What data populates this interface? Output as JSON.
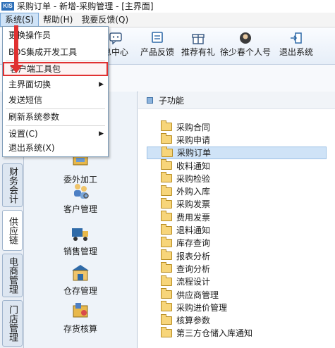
{
  "window": {
    "title": "采购订单 - 新增-采购管理 - [主界面]",
    "logo": "KIS"
  },
  "menubar": {
    "items": [
      "系统(S)",
      "帮助(H)",
      "我要反馈(Q)"
    ]
  },
  "toolbar": {
    "buttons": [
      "息中心",
      "产品反馈",
      "推荐有礼",
      "徐少春个人号",
      "退出系统"
    ]
  },
  "dropdown": {
    "items": [
      "更换操作员",
      "BOS集成开发工具",
      "客户端工具包",
      "主界面切换",
      "发送短信",
      "刷新系统参数",
      "设置(C)",
      "退出系统(X)"
    ],
    "submenu_arrow": "▶"
  },
  "left_tabs": [
    "财务会计",
    "供应链",
    "电商管理",
    "门店管理"
  ],
  "modules": [
    "委外加工",
    "客户管理",
    "销售管理",
    "仓存管理",
    "存货核算"
  ],
  "subfunctions": {
    "header": "子功能",
    "items": [
      "采购合同",
      "采购申请",
      "采购订单",
      "收料通知",
      "采购检验",
      "外购入库",
      "采购发票",
      "费用发票",
      "退料通知",
      "库存查询",
      "报表分析",
      "查询分析",
      "流程设计",
      "供应商管理",
      "采购进价管理",
      "核算参数",
      "第三方仓储入库通知"
    ],
    "selected": "采购订单"
  },
  "colors": {
    "highlight": "#e03131",
    "selection": "#cfe3f7",
    "accent": "#2d6fb8"
  }
}
